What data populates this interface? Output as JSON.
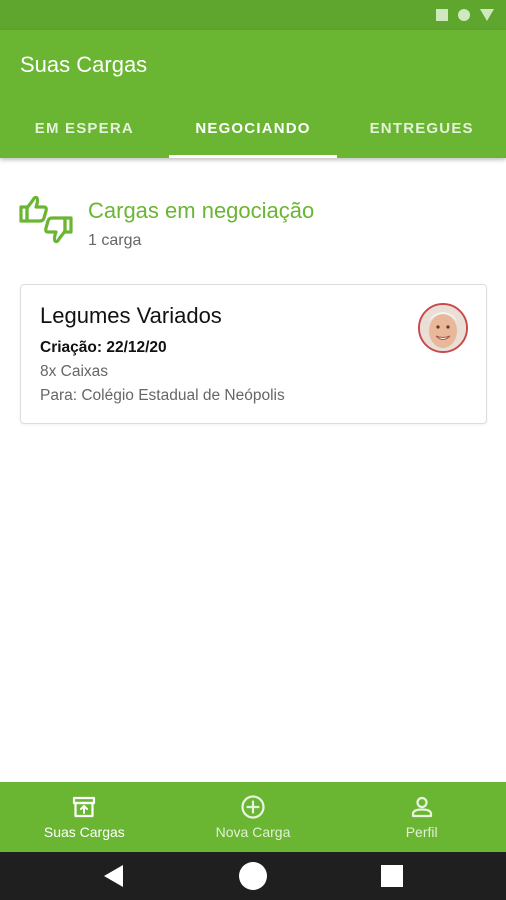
{
  "app_bar": {
    "title": "Suas Cargas",
    "tabs": [
      {
        "label": "EM ESPERA",
        "active": false
      },
      {
        "label": "NEGOCIANDO",
        "active": true
      },
      {
        "label": "ENTREGUES",
        "active": false
      }
    ]
  },
  "section": {
    "icon": "thumbs-up-down-icon",
    "title": "Cargas em negociação",
    "count": "1 carga"
  },
  "cards": [
    {
      "title": "Legumes Variados",
      "date": "Criação: 22/12/20",
      "quantity": "8x Caixas",
      "destination": "Para: Colégio Estadual de Neópolis",
      "avatar": "user-avatar"
    }
  ],
  "bottom_nav": {
    "items": [
      {
        "label": "Suas Cargas",
        "icon": "archive-icon",
        "active": true
      },
      {
        "label": "Nova Carga",
        "icon": "add-circle-icon",
        "active": false
      },
      {
        "label": "Perfil",
        "icon": "person-icon",
        "active": false
      }
    ]
  },
  "colors": {
    "primary": "#6ab632",
    "status_bar": "#5fa62f",
    "system_nav": "#1f1f1f"
  }
}
